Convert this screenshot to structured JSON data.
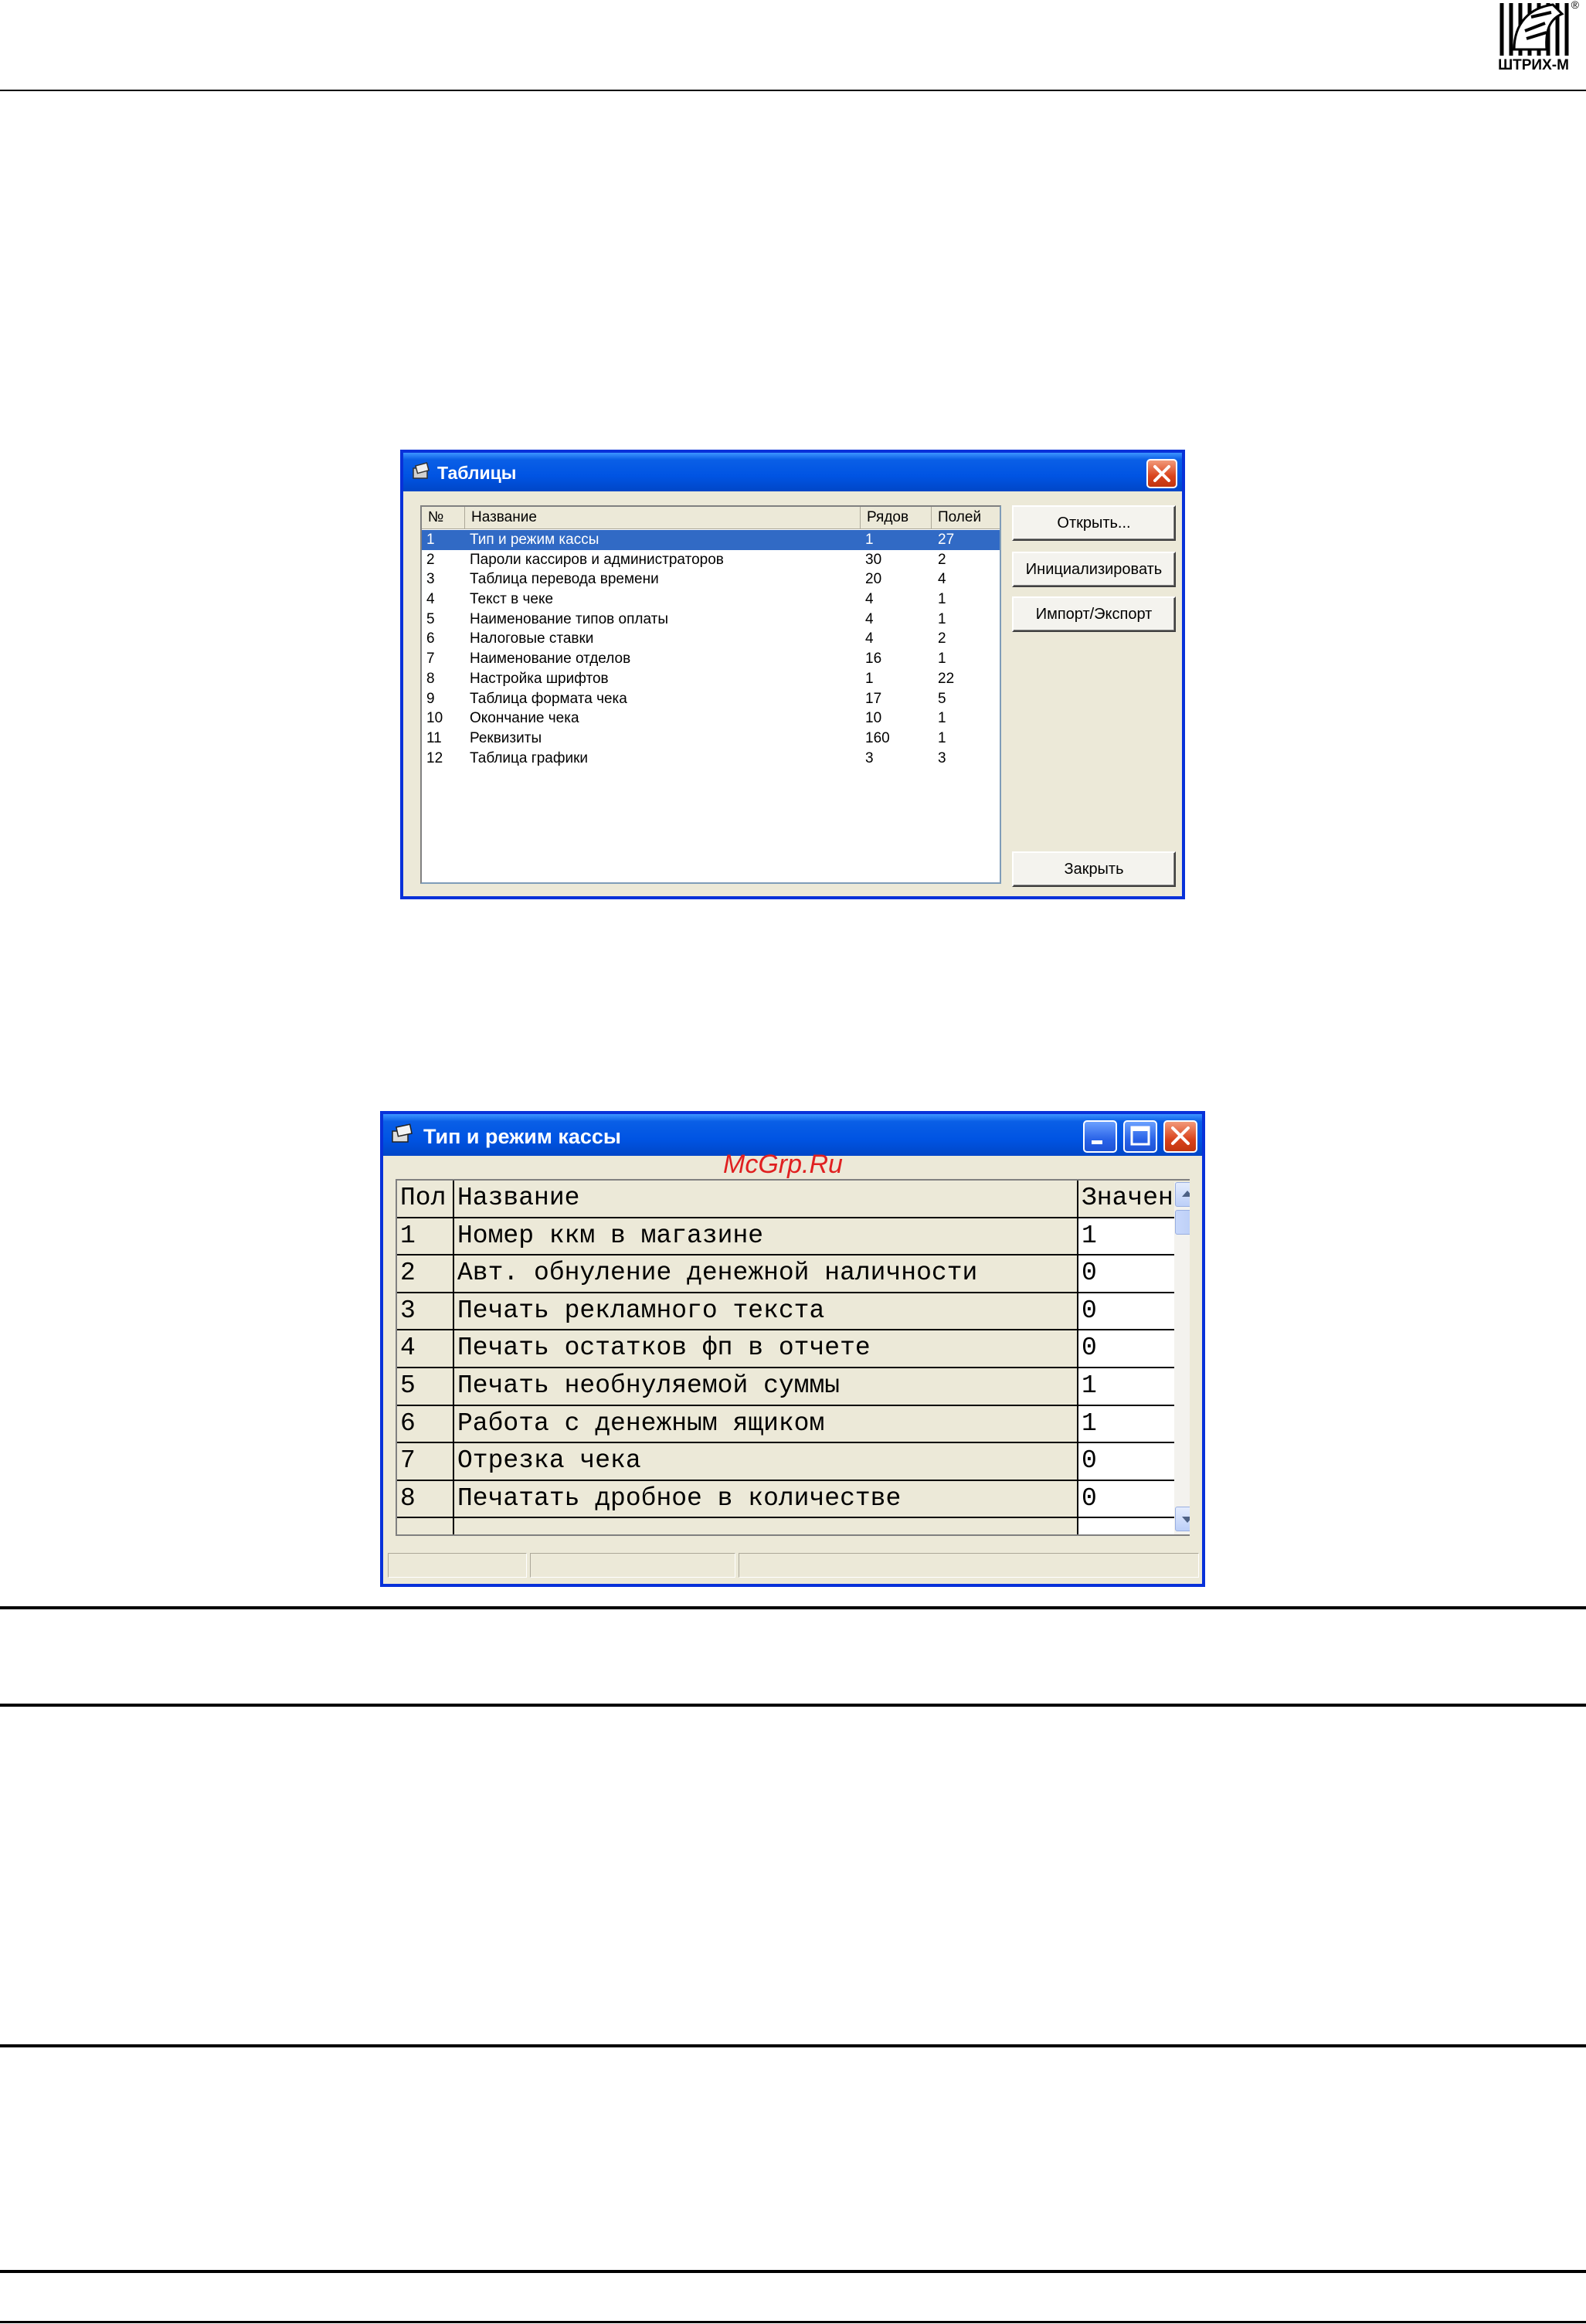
{
  "logo": {
    "text": "ШТРИХ-М",
    "reg": "®"
  },
  "tables_window": {
    "title": "Таблицы",
    "icon": "tables-app-icon",
    "columns": [
      "№",
      "Название",
      "Рядов",
      "Полей"
    ],
    "rows": [
      {
        "num": "1",
        "name": "Тип и режим кассы",
        "rows": "1",
        "fields": "27",
        "selected": true
      },
      {
        "num": "2",
        "name": "Пароли кассиров и администраторов",
        "rows": "30",
        "fields": "2"
      },
      {
        "num": "3",
        "name": "Таблица перевода времени",
        "rows": "20",
        "fields": "4"
      },
      {
        "num": "4",
        "name": "Текст в чеке",
        "rows": "4",
        "fields": "1"
      },
      {
        "num": "5",
        "name": "Наименование типов оплаты",
        "rows": "4",
        "fields": "1"
      },
      {
        "num": "6",
        "name": "Налоговые ставки",
        "rows": "4",
        "fields": "2"
      },
      {
        "num": "7",
        "name": "Наименование отделов",
        "rows": "16",
        "fields": "1"
      },
      {
        "num": "8",
        "name": "Настройка шрифтов",
        "rows": "1",
        "fields": "22"
      },
      {
        "num": "9",
        "name": "Таблица формата чека",
        "rows": "17",
        "fields": "5"
      },
      {
        "num": "10",
        "name": "Окончание чека",
        "rows": "10",
        "fields": "1"
      },
      {
        "num": "11",
        "name": "Реквизиты",
        "rows": "160",
        "fields": "1"
      },
      {
        "num": "12",
        "name": "Таблица графики",
        "rows": "3",
        "fields": "3"
      }
    ],
    "buttons": {
      "open": "Открыть...",
      "init": "Инициализировать",
      "import_export": "Импорт/Экспорт",
      "close": "Закрыть"
    }
  },
  "table_window": {
    "title": "Тип и режим кассы",
    "watermark": "McGrp.Ru",
    "columns": [
      "Пол",
      "Название",
      "Значени"
    ],
    "rows": [
      {
        "field": "1",
        "name": "Номер ккм в магазине",
        "value": "1"
      },
      {
        "field": "2",
        "name": "Авт. обнуление денежной наличности",
        "value": "0"
      },
      {
        "field": "3",
        "name": "Печать рекламного текста",
        "value": "0"
      },
      {
        "field": "4",
        "name": "Печать остатков фп в отчете",
        "value": "0"
      },
      {
        "field": "5",
        "name": "Печать необнуляемой суммы",
        "value": "1"
      },
      {
        "field": "6",
        "name": "Работа с денежным ящиком",
        "value": "1"
      },
      {
        "field": "7",
        "name": "Отрезка чека",
        "value": "0"
      },
      {
        "field": "8",
        "name": "Печатать дробное в количестве",
        "value": "0"
      }
    ]
  }
}
